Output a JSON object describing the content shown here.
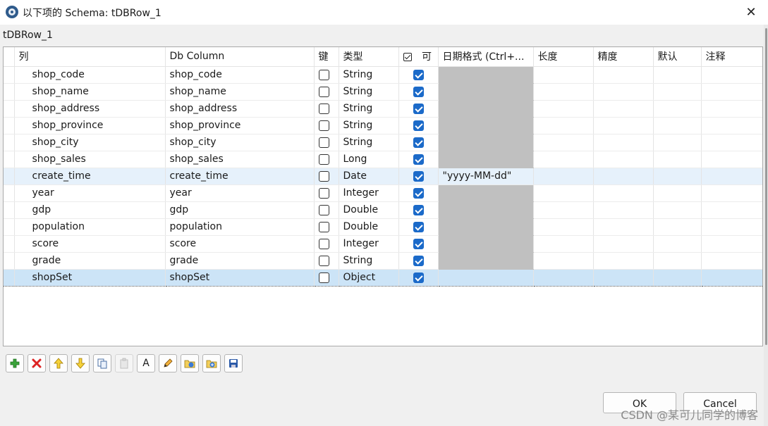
{
  "window": {
    "title": "以下项的 Schema: tDBRow_1",
    "close_glyph": "✕"
  },
  "subtitle": "tDBRow_1",
  "table": {
    "headers": {
      "column": "列",
      "db_column": "Db Column",
      "key": "键",
      "type": "类型",
      "nullable": "可",
      "date_format": "日期格式 (Ctrl+...",
      "length": "长度",
      "precision": "精度",
      "default": "默认",
      "comment": "注释"
    },
    "rows": [
      {
        "column": "shop_code",
        "db_column": "shop_code",
        "key": false,
        "type": "String",
        "nullable": true,
        "date_format": "",
        "date_disabled": true
      },
      {
        "column": "shop_name",
        "db_column": "shop_name",
        "key": false,
        "type": "String",
        "nullable": true,
        "date_format": "",
        "date_disabled": true
      },
      {
        "column": "shop_address",
        "db_column": "shop_address",
        "key": false,
        "type": "String",
        "nullable": true,
        "date_format": "",
        "date_disabled": true
      },
      {
        "column": "shop_province",
        "db_column": "shop_province",
        "key": false,
        "type": "String",
        "nullable": true,
        "date_format": "",
        "date_disabled": true
      },
      {
        "column": "shop_city",
        "db_column": "shop_city",
        "key": false,
        "type": "String",
        "nullable": true,
        "date_format": "",
        "date_disabled": true
      },
      {
        "column": "shop_sales",
        "db_column": "shop_sales",
        "key": false,
        "type": "Long",
        "nullable": true,
        "date_format": "",
        "date_disabled": true
      },
      {
        "column": "create_time",
        "db_column": "create_time",
        "key": false,
        "type": "Date",
        "nullable": true,
        "date_format": "\"yyyy-MM-dd\"",
        "date_disabled": false
      },
      {
        "column": "year",
        "db_column": "year",
        "key": false,
        "type": "Integer",
        "nullable": true,
        "date_format": "",
        "date_disabled": true
      },
      {
        "column": "gdp",
        "db_column": "gdp",
        "key": false,
        "type": "Double",
        "nullable": true,
        "date_format": "",
        "date_disabled": true
      },
      {
        "column": "population",
        "db_column": "population",
        "key": false,
        "type": "Double",
        "nullable": true,
        "date_format": "",
        "date_disabled": true
      },
      {
        "column": "score",
        "db_column": "score",
        "key": false,
        "type": "Integer",
        "nullable": true,
        "date_format": "",
        "date_disabled": true
      },
      {
        "column": "grade",
        "db_column": "grade",
        "key": false,
        "type": "String",
        "nullable": true,
        "date_format": "",
        "date_disabled": true
      },
      {
        "column": "shopSet",
        "db_column": "shopSet",
        "key": false,
        "type": "Object",
        "nullable": true,
        "date_format": "",
        "date_disabled": false
      }
    ],
    "highlighted_row": 6,
    "selected_row": 12
  },
  "toolbar": {
    "icons": [
      "add-icon",
      "delete-icon",
      "move-up-icon",
      "move-down-icon",
      "copy-icon",
      "paste-icon",
      "text-icon",
      "edit-icon",
      "import-icon",
      "export-icon",
      "save-icon"
    ],
    "text_button_label": "A"
  },
  "buttons": {
    "ok": "OK",
    "cancel": "Cancel"
  },
  "watermark": "CSDN @某可儿同学的博客",
  "colors": {
    "accent": "#1b6ac9",
    "disabled_cell": "#c0c0c0",
    "selected_row": "#cce4f7",
    "highlight_row": "#e6f1fb"
  }
}
